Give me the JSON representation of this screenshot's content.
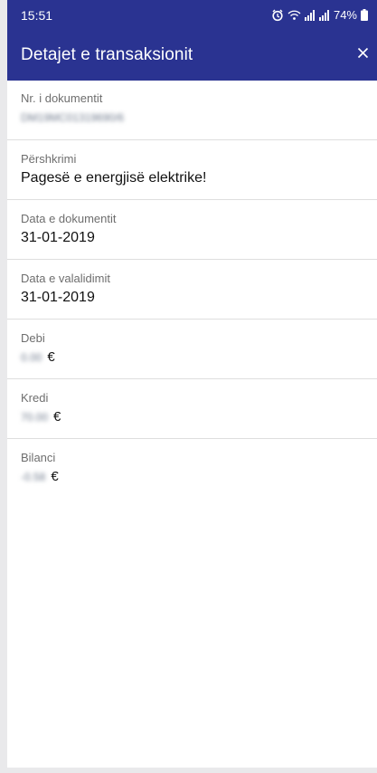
{
  "status_bar": {
    "time": "15:51",
    "battery": "74%"
  },
  "app_bar": {
    "title": "Detajet e transaksionit",
    "close_icon": "close-icon"
  },
  "fields": [
    {
      "label": "Nr. i dokumentit",
      "value": "DM19MC01319690/6",
      "obscured": true
    },
    {
      "label": "Përshkrimi",
      "value": "Pagesë e energjisë elektrike!"
    },
    {
      "label": "Data e dokumentit",
      "value": "31-01-2019"
    },
    {
      "label": "Data e valalidimit",
      "value": "31-01-2019"
    },
    {
      "label": "Debi",
      "amount": "0.00",
      "currency": "€",
      "obscured": true
    },
    {
      "label": "Kredi",
      "amount": "70.00",
      "currency": "€",
      "obscured": true
    },
    {
      "label": "Bilanci",
      "amount": "-0.58",
      "currency": "€",
      "obscured": true
    }
  ],
  "colors": {
    "primary": "#2a3391",
    "divider": "#dedede",
    "label": "#6e6e6e"
  }
}
